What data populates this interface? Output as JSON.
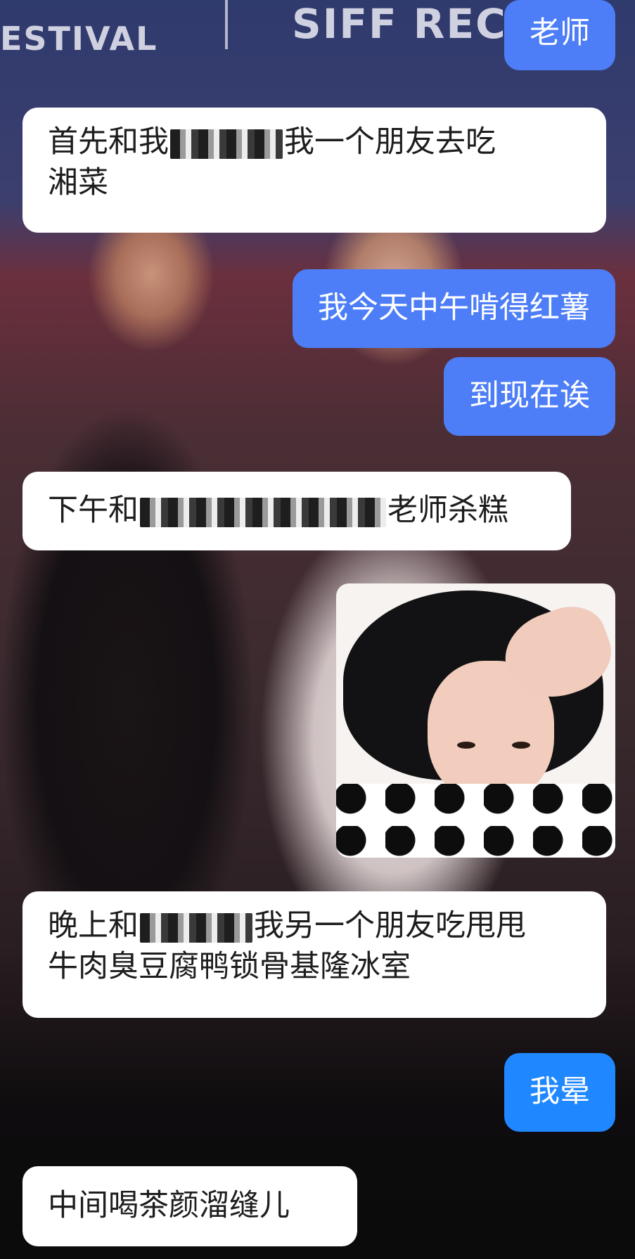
{
  "backdrop": {
    "logo_left": "ESTIVAL",
    "logo_right": "SIFF REC"
  },
  "messages": [
    {
      "side": "out",
      "text": "老师"
    },
    {
      "side": "in",
      "line1_before": "首先和我",
      "line1_after": "我一个朋友去吃",
      "line2": "湘菜",
      "redacted": true
    },
    {
      "side": "out",
      "text": "我今天中午啃得红薯"
    },
    {
      "side": "out",
      "text": "到现在诶"
    },
    {
      "side": "in",
      "before": "下午和",
      "after": "老师杀糕",
      "redacted": true
    },
    {
      "side": "out",
      "type": "sticker",
      "sticker": "crying-girl-sticker"
    },
    {
      "side": "in",
      "line1_before": "晚上和",
      "line1_after": "我另一个朋友吃甩甩",
      "line2": "牛肉臭豆腐鸭锁骨基隆冰室",
      "redacted": true
    },
    {
      "side": "out",
      "text": "我晕"
    },
    {
      "side": "in",
      "text": "中间喝茶颜溜缝儿"
    }
  ],
  "colors": {
    "outgoing_bubble": "#4d7ef7",
    "outgoing_bubble_alt": "#1f87ff",
    "incoming_bubble": "#ffffff"
  }
}
